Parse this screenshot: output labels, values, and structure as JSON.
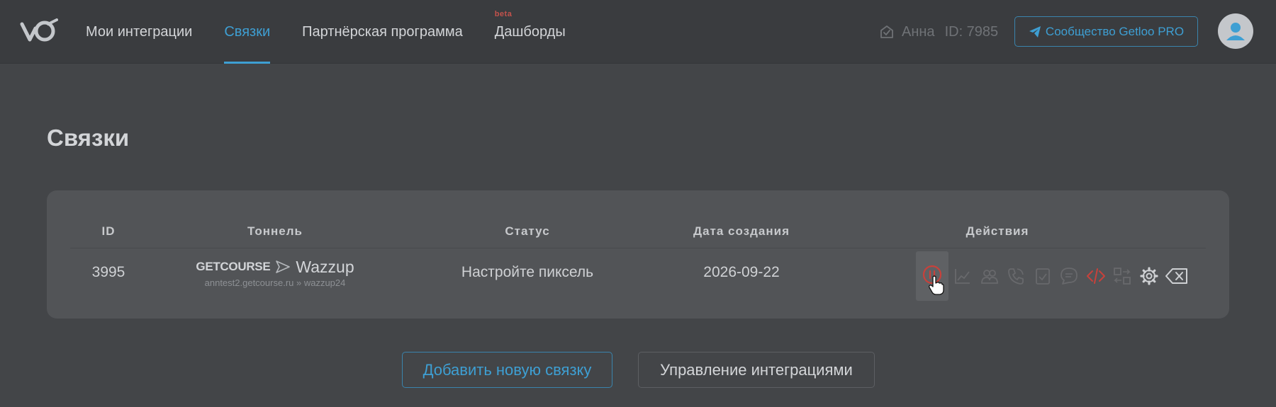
{
  "header": {
    "nav": [
      {
        "label": "Мои интеграции",
        "active": false
      },
      {
        "label": "Связки",
        "active": true
      },
      {
        "label": "Партнёрская программа",
        "active": false
      },
      {
        "label": "Дашборды",
        "active": false,
        "badge": "beta"
      }
    ],
    "user": {
      "name": "Анна",
      "id_label": "ID: 7985"
    },
    "community_button": "Сообщество Getloo PRO"
  },
  "page": {
    "title": "Связки"
  },
  "table": {
    "columns": [
      "ID",
      "Тоннель",
      "Статус",
      "Дата создания",
      "Действия"
    ],
    "rows": [
      {
        "id": "3995",
        "tunnel": {
          "from": "GETCOURSE",
          "to": "Wazzup",
          "subtitle": "anntest2.getcourse.ru » wazzup24"
        },
        "status": "Настройте пиксель",
        "created": "2026-09-22"
      }
    ],
    "actions": [
      "pause-icon",
      "chart-icon",
      "users-icon",
      "phone-icon",
      "task-check-icon",
      "chat-icon",
      "code-icon",
      "swap-icon",
      "gear-icon",
      "delete-icon"
    ]
  },
  "buttons": {
    "add": "Добавить новую связку",
    "manage": "Управление интеграциями"
  },
  "colors": {
    "accent": "#3e9fd3",
    "danger": "#c8413b",
    "background": "#434548",
    "card": "#525457"
  }
}
